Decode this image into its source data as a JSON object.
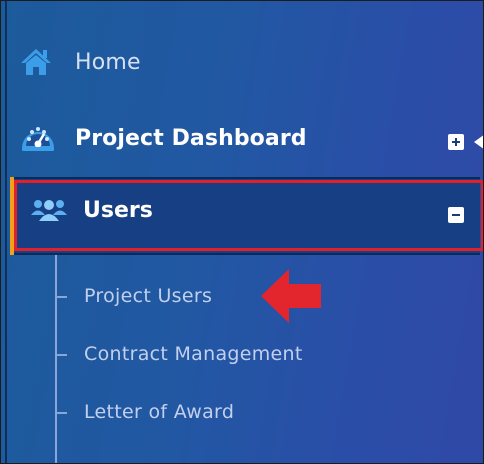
{
  "nav": {
    "home": {
      "label": "Home",
      "icon": "home-icon"
    },
    "dashboard": {
      "label": "Project Dashboard",
      "icon": "dashboard-gauge-icon",
      "toggle": "expand-plus-icon"
    },
    "users": {
      "label": "Users",
      "icon": "users-group-icon",
      "toggle": "collapse-minus-icon"
    },
    "users_submenu": [
      {
        "label": "Project Users"
      },
      {
        "label": "Contract Management"
      },
      {
        "label": "Letter of Award"
      }
    ]
  },
  "colors": {
    "sidebar_background": "#2257a3",
    "active_row": "#173f83",
    "highlight_red": "#e0202a",
    "accent_orange": "#f0a21a",
    "icon_blue": "#3c9ee8"
  }
}
